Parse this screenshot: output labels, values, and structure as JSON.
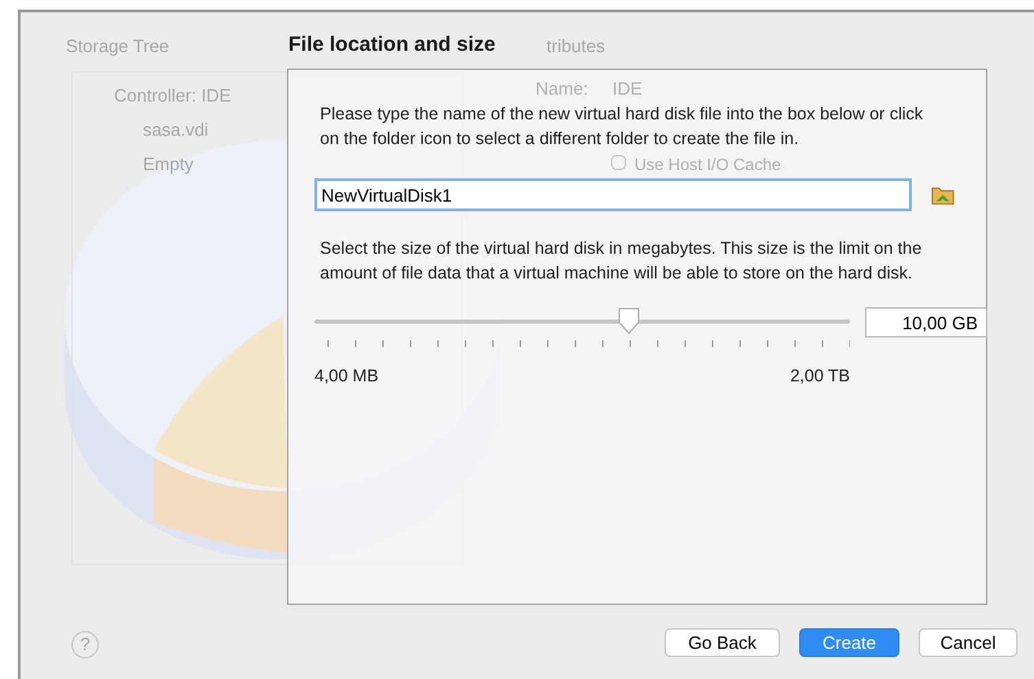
{
  "background": {
    "storage_tree": {
      "title": "Storage Tree",
      "items": [
        {
          "label": "Controller: IDE",
          "children": [
            {
              "label": "sasa.vdi"
            },
            {
              "label": "Empty"
            }
          ]
        }
      ]
    },
    "attributes": {
      "title": "tributes",
      "name_label": "Name:",
      "name_value": "IDE",
      "checkbox": {
        "label": "Use Host I/O Cache",
        "checked": false
      }
    },
    "help_button": "?"
  },
  "dialog": {
    "title": "File location and size",
    "location_text": "Please type the name of the new virtual hard disk file into the box below or click on the folder icon to select a different folder to create the file in.",
    "file_name": "NewVirtualDisk1",
    "size_text": "Select the size of the virtual hard disk in megabytes. This size is the limit on the amount of file data that a virtual machine will be able to store on the hard disk.",
    "size_slider": {
      "level": 0.587,
      "min_label": "4,00 MB",
      "max_label": "2,00 TB"
    },
    "size_value": "10,00 GB"
  },
  "buttons": [
    {
      "label": "Go Back",
      "default": false
    },
    {
      "label": "Create",
      "default": true
    },
    {
      "label": "Cancel",
      "default": false
    }
  ]
}
